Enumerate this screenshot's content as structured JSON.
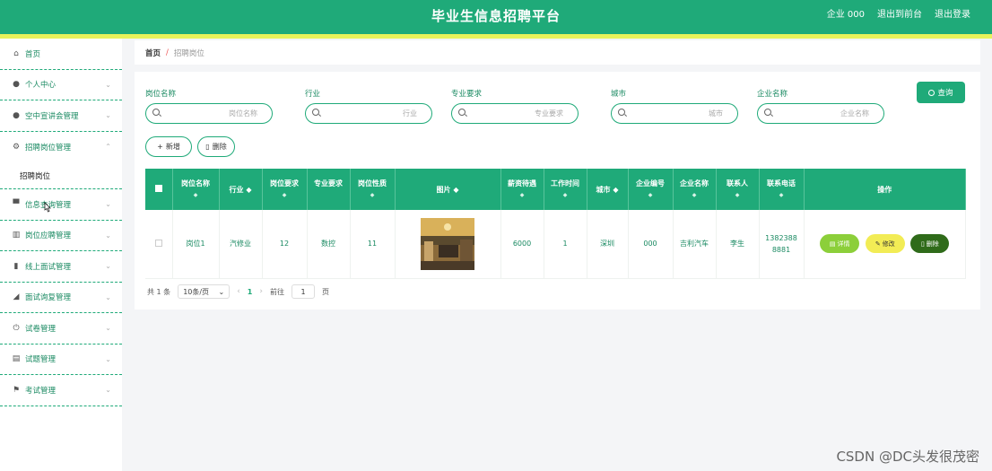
{
  "header": {
    "title": "毕业生信息招聘平台",
    "user": "企业 000",
    "back_front": "退出到前台",
    "logout": "退出登录"
  },
  "sidebar": {
    "items": [
      {
        "label": "首页",
        "icon": "home-icon",
        "expandable": false
      },
      {
        "label": "个人中心",
        "icon": "user-icon",
        "expandable": true
      },
      {
        "label": "空中宣讲会管理",
        "icon": "user-icon",
        "expandable": true
      },
      {
        "label": "招聘岗位管理",
        "icon": "settings-icon",
        "expandable": true,
        "expanded": true
      },
      {
        "label": "信息查询管理",
        "icon": "monitor-icon",
        "expandable": true
      },
      {
        "label": "岗位应聘管理",
        "icon": "building-icon",
        "expandable": true
      },
      {
        "label": "线上面试管理",
        "icon": "bar-chart-icon",
        "expandable": true
      },
      {
        "label": "面试询复管理",
        "icon": "area-chart-icon",
        "expandable": true
      },
      {
        "label": "试卷管理",
        "icon": "power-icon",
        "expandable": true
      },
      {
        "label": "试题管理",
        "icon": "clipboard-icon",
        "expandable": true
      },
      {
        "label": "考试管理",
        "icon": "flag-icon",
        "expandable": true
      }
    ],
    "sub_item": "招聘岗位"
  },
  "breadcrumb": {
    "home": "首页",
    "separator": "/",
    "current": "招聘岗位"
  },
  "search": {
    "fields": [
      {
        "label": "岗位名称",
        "placeholder": "岗位名称"
      },
      {
        "label": "行业",
        "placeholder": "行业"
      },
      {
        "label": "专业要求",
        "placeholder": "专业要求"
      },
      {
        "label": "城市",
        "placeholder": "城市"
      },
      {
        "label": "企业名称",
        "placeholder": "企业名称"
      }
    ],
    "button": "查询"
  },
  "actions": {
    "add": "新增",
    "delete": "删除"
  },
  "table": {
    "headers": [
      "岗位名称",
      "行业",
      "岗位要求",
      "专业要求",
      "岗位性质",
      "图片",
      "薪资待遇",
      "工作时间",
      "城市",
      "企业编号",
      "企业名称",
      "联系人",
      "联系电话",
      "操作"
    ],
    "sortable": [
      true,
      true,
      true,
      false,
      true,
      true,
      true,
      true,
      true,
      true,
      true,
      true,
      true,
      false
    ],
    "rows": [
      {
        "job_name": "岗位1",
        "industry": "汽修业",
        "requirement": "12",
        "major": "数控",
        "nature": "11",
        "salary": "6000",
        "work_time": "1",
        "city": "深圳",
        "company_no": "000",
        "company_name": "吉利汽车",
        "contact": "李生",
        "phone": "13823888881"
      }
    ],
    "ops": {
      "detail": "详情",
      "edit": "修改",
      "delete": "删除"
    }
  },
  "pagination": {
    "total": "共 1 条",
    "page_size": "10条/页",
    "current_page": "1",
    "goto_label": "前往",
    "goto_value": "1",
    "page_suffix": "页"
  },
  "watermark": "CSDN @DC头发很茂密",
  "colors": {
    "primary": "#1faa79",
    "accent_stripe": "#e8f25a",
    "detail": "#8ccf3a",
    "edit": "#f2ec55",
    "delete": "#2f6b1a"
  }
}
